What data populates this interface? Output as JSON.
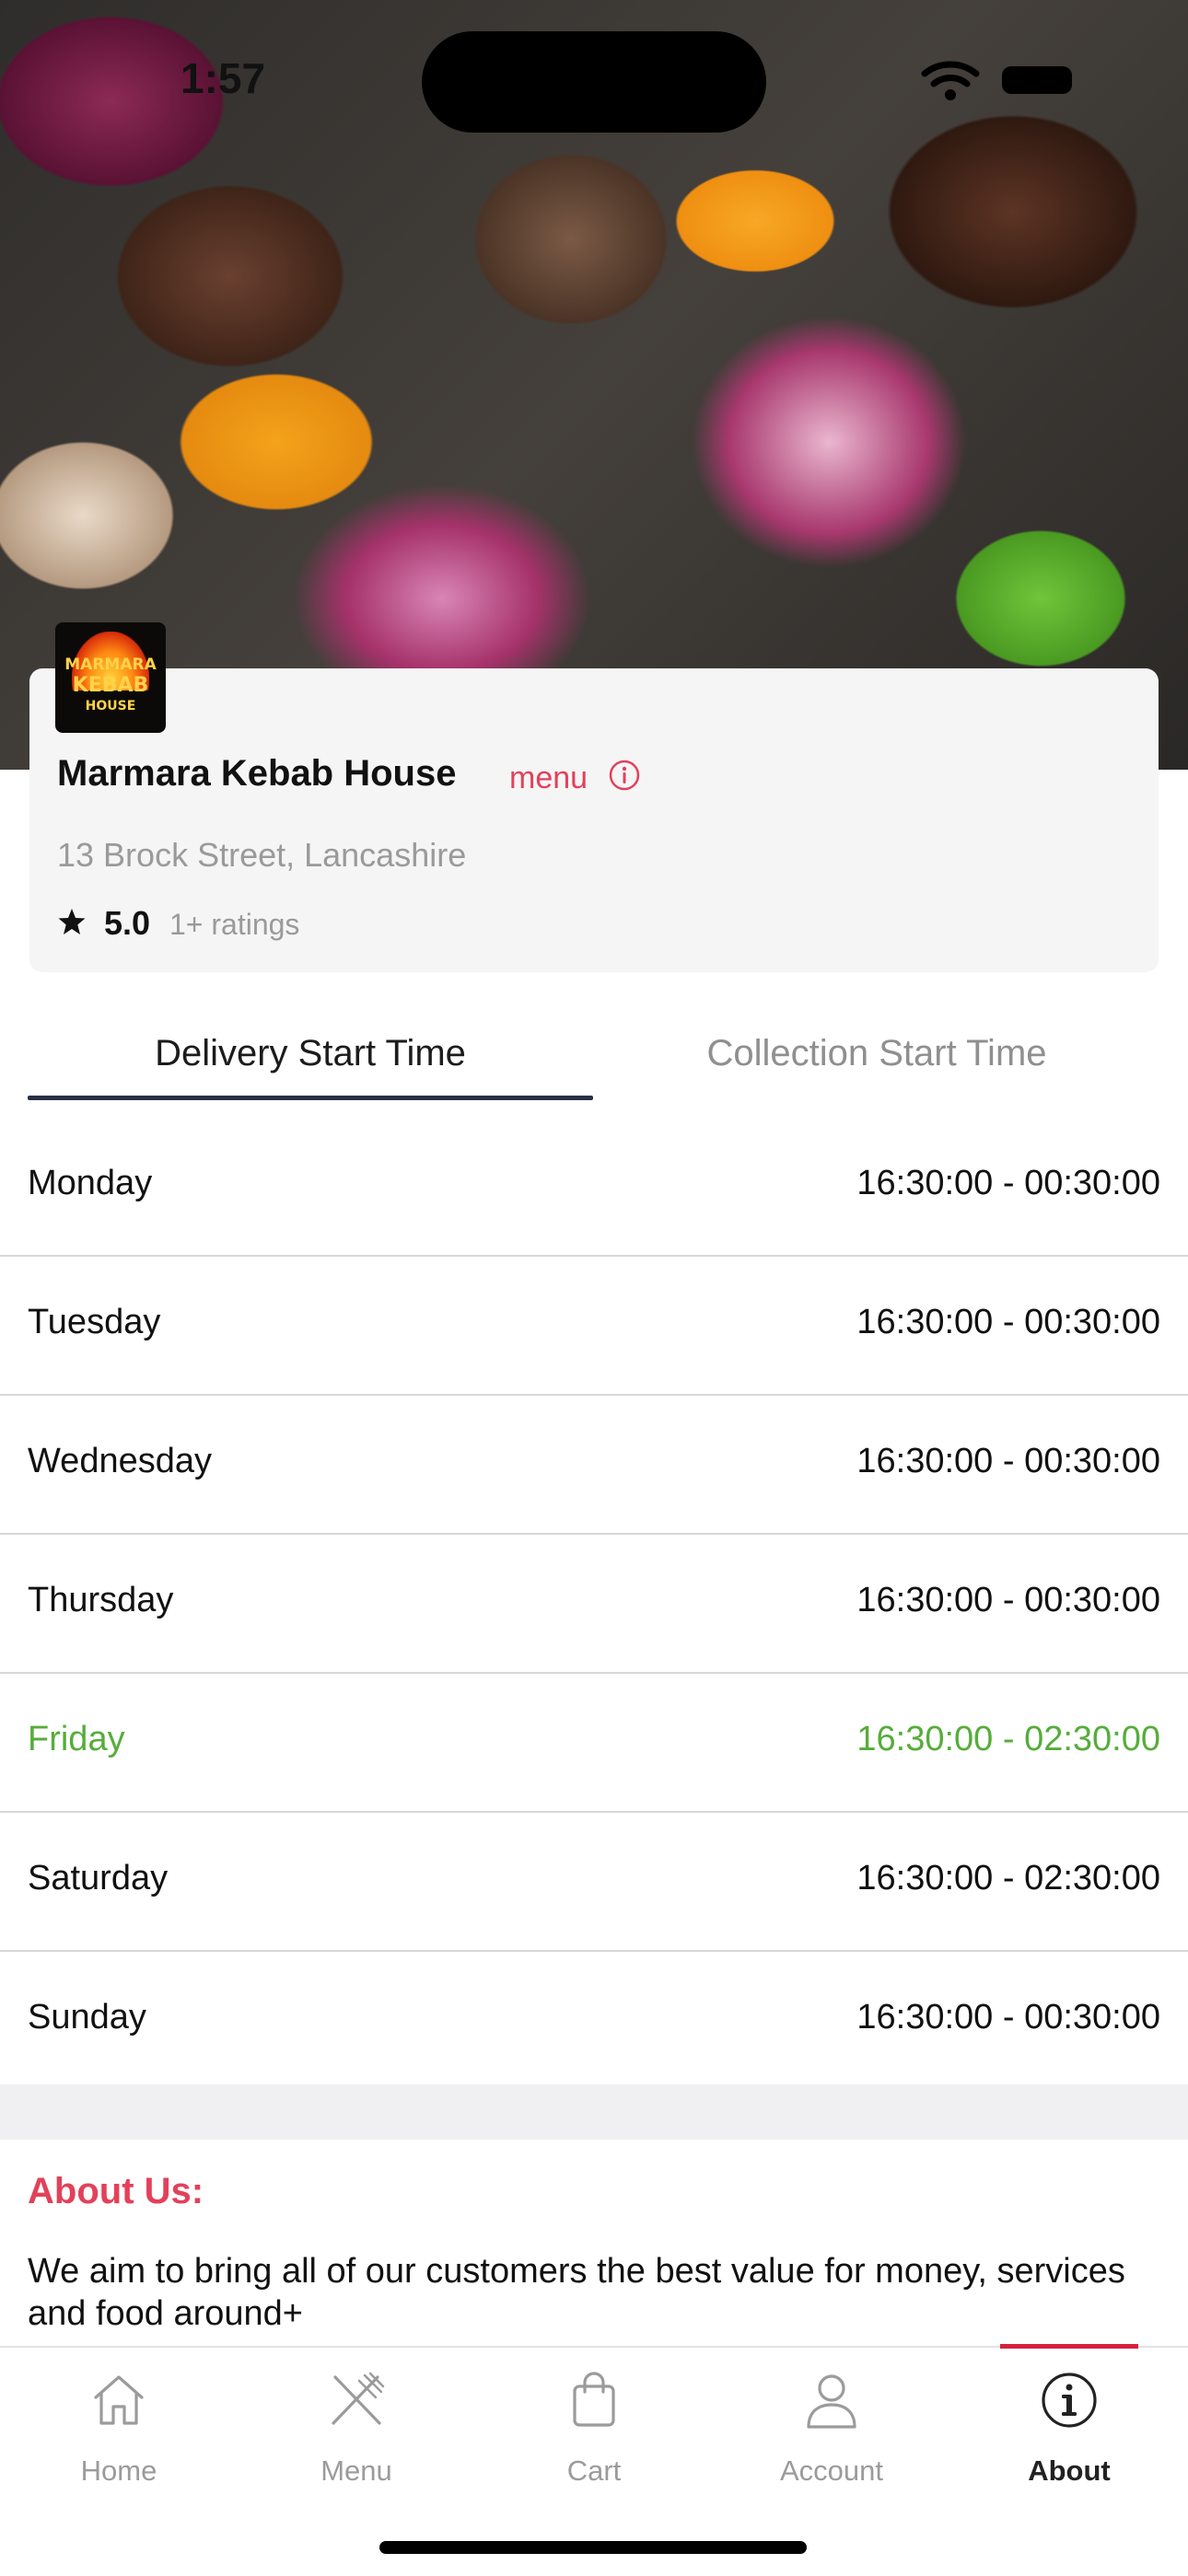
{
  "status_bar": {
    "time": "1:57"
  },
  "restaurant": {
    "logo_text": [
      "MARMARA",
      "KEBAB",
      "HOUSE"
    ],
    "name": "Marmara Kebab House",
    "menu_link": "menu",
    "address": "13 Brock Street, Lancashire",
    "rating": "5.0",
    "ratings_count": "1+ ratings"
  },
  "tabs": [
    {
      "label": "Delivery Start Time",
      "active": true
    },
    {
      "label": "Collection Start Time",
      "active": false
    }
  ],
  "hours": [
    {
      "day": "Monday",
      "time": "16:30:00 - 00:30:00",
      "highlight": false
    },
    {
      "day": "Tuesday",
      "time": "16:30:00 - 00:30:00",
      "highlight": false
    },
    {
      "day": "Wednesday",
      "time": "16:30:00 - 00:30:00",
      "highlight": false
    },
    {
      "day": "Thursday",
      "time": "16:30:00 - 00:30:00",
      "highlight": false
    },
    {
      "day": "Friday",
      "time": "16:30:00 - 02:30:00",
      "highlight": true
    },
    {
      "day": "Saturday",
      "time": "16:30:00 - 02:30:00",
      "highlight": false
    },
    {
      "day": "Sunday",
      "time": "16:30:00 - 00:30:00",
      "highlight": false
    }
  ],
  "about": {
    "title": "About Us:",
    "text": "We aim to bring all of our customers the best value for money, services and food around+"
  },
  "nav": {
    "items": [
      {
        "label": "Home",
        "icon": "home-icon"
      },
      {
        "label": "Menu",
        "icon": "fork-knife-icon"
      },
      {
        "label": "Cart",
        "icon": "shopping-bag-icon"
      },
      {
        "label": "Account",
        "icon": "user-icon"
      },
      {
        "label": "About",
        "icon": "info-icon"
      }
    ],
    "active": "About"
  },
  "colors": {
    "accent": "#e3415a",
    "today_highlight": "#56ad3a",
    "active_nav_bar": "#d5213d",
    "tab_underline": "#283044"
  }
}
